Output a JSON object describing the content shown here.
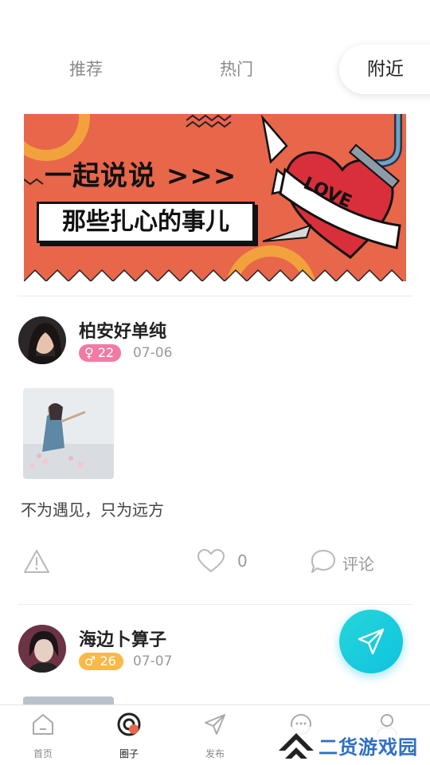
{
  "tabs": [
    {
      "label": "推荐",
      "active": false
    },
    {
      "label": "热门",
      "active": false
    },
    {
      "label": "附近",
      "active": true
    }
  ],
  "banner": {
    "line1": "一起说说 >>>",
    "line2": "那些扎心的事儿",
    "heart_text": "LOVE",
    "bg_color": "#e8664a"
  },
  "posts": [
    {
      "username": "柏安好单纯",
      "gender": "female",
      "gender_symbol": "♀",
      "age": "22",
      "date": "07-06",
      "text": "不为遇见，只为远方",
      "like_count": "0",
      "comment_label": "评论"
    },
    {
      "username": "海边卜算子",
      "gender": "male",
      "gender_symbol": "♂",
      "age": "26",
      "date": "07-07"
    }
  ],
  "nav": [
    {
      "label": "首页",
      "icon": "home-icon",
      "active": false
    },
    {
      "label": "圈子",
      "icon": "circle-icon",
      "active": true
    },
    {
      "label": "发布",
      "icon": "send-icon",
      "active": false
    },
    {
      "label": "",
      "icon": "chat-icon",
      "active": false
    },
    {
      "label": "",
      "icon": "profile-icon",
      "active": false
    }
  ],
  "fab_icon": "send-icon",
  "watermark": "二货游戏园",
  "colors": {
    "accent": "#0ec3e0",
    "female": "#f27aa4",
    "male": "#f8b948"
  }
}
